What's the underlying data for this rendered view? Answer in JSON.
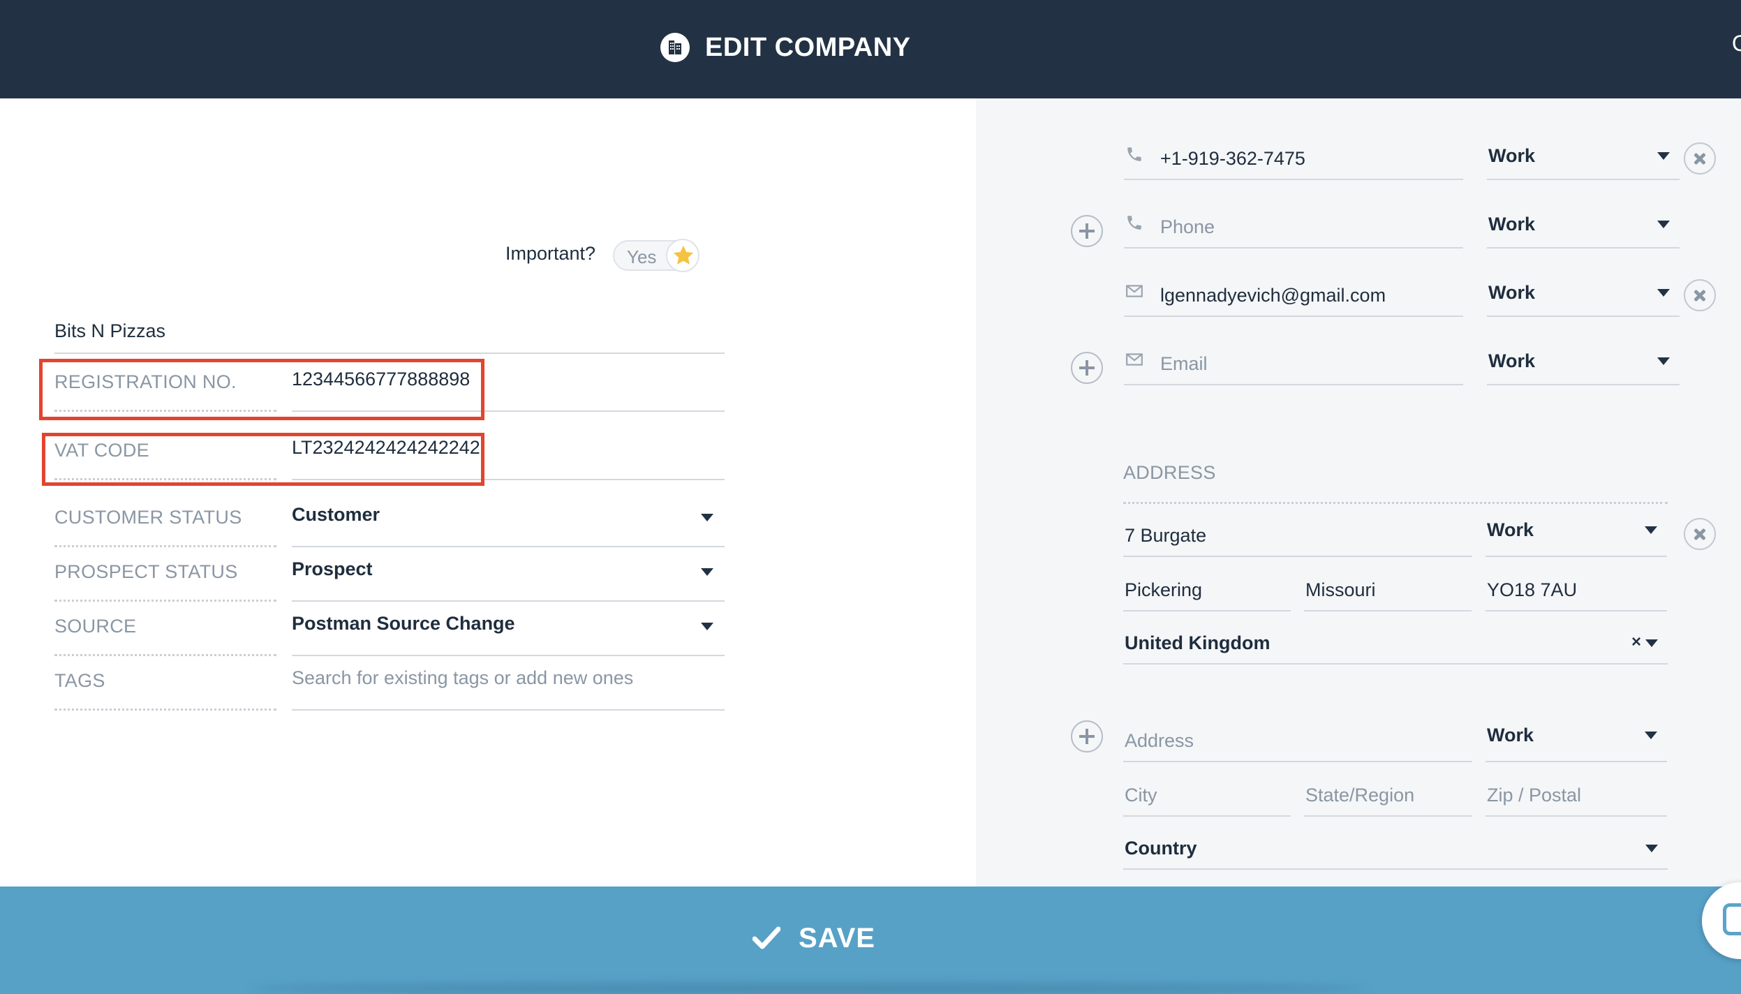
{
  "header": {
    "title": "EDIT COMPANY",
    "right_partial": "C"
  },
  "important": {
    "label": "Important?",
    "toggle_text": "Yes",
    "starred": true
  },
  "company": {
    "name": "Bits N Pizzas"
  },
  "fields": {
    "registration": {
      "label": "REGISTRATION NO.",
      "value": "12344566777888898"
    },
    "vat": {
      "label": "VAT CODE",
      "value": "LT2324242424242242"
    },
    "customer_status": {
      "label": "CUSTOMER STATUS",
      "value": "Customer"
    },
    "prospect_status": {
      "label": "PROSPECT STATUS",
      "value": "Prospect"
    },
    "source": {
      "label": "SOURCE",
      "value": "Postman Source Change"
    },
    "tags": {
      "label": "TAGS",
      "placeholder": "Search for existing tags or add new ones"
    }
  },
  "contacts": {
    "phone_1": {
      "value": "+1-919-362-7475",
      "type": "Work"
    },
    "phone_new": {
      "placeholder": "Phone",
      "type": "Work"
    },
    "email_1": {
      "value": "lgennadyevich@gmail.com",
      "type": "Work"
    },
    "email_new": {
      "placeholder": "Email",
      "type": "Work"
    }
  },
  "address": {
    "heading": "ADDRESS",
    "existing": {
      "street": "7 Burgate",
      "type": "Work",
      "city": "Pickering",
      "state": "Missouri",
      "zip": "YO18 7AU",
      "country": "United Kingdom",
      "clear": "×"
    },
    "new": {
      "street_placeholder": "Address",
      "type": "Work",
      "city_placeholder": "City",
      "state_placeholder": "State/Region",
      "zip_placeholder": "Zip / Postal",
      "country_placeholder": "Country"
    }
  },
  "footer": {
    "save_label": "SAVE"
  },
  "colors": {
    "header_bg": "#223244",
    "footer_bg": "#57a1c7",
    "highlight": "#e2452f",
    "right_panel_bg": "#f4f6f8",
    "star": "#f5c242"
  },
  "icons": [
    "building-icon",
    "star-icon",
    "phone-icon",
    "email-icon",
    "plus-icon",
    "remove-icon",
    "check-icon",
    "chevron-down-icon",
    "chat-icon"
  ]
}
